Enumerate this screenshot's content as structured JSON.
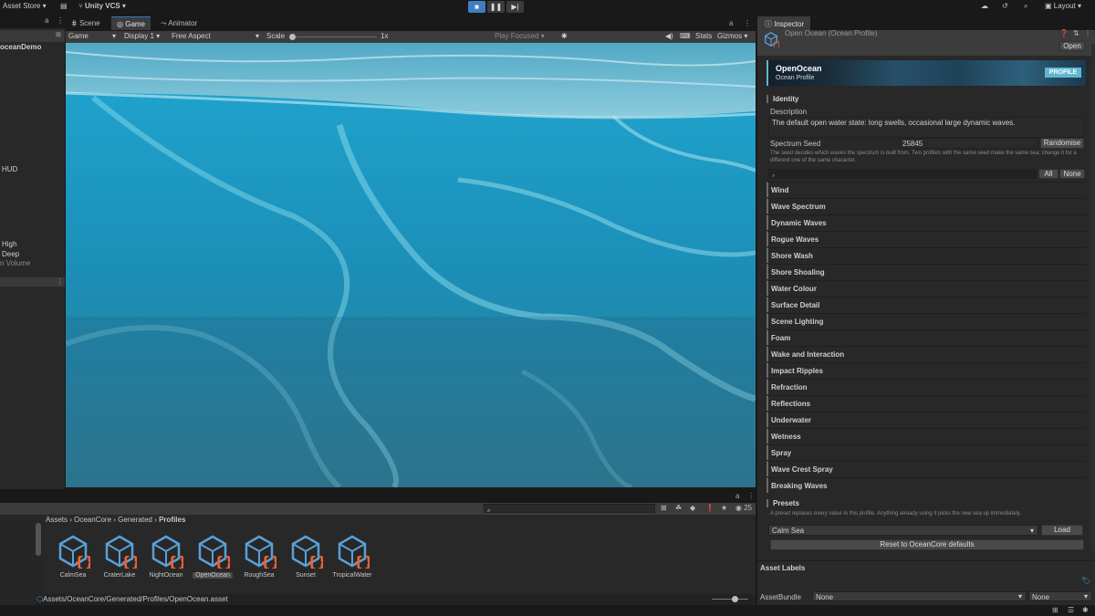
{
  "toolbar": {
    "asset_store": "Asset Store",
    "vcs": "Unity VCS",
    "layout": "Layout"
  },
  "hierarchy": {
    "rows": [
      "oceanDemo",
      "HUD",
      "High",
      "Deep",
      "n Volume"
    ]
  },
  "game_view": {
    "tabs": [
      "Scene",
      "Game",
      "Animator"
    ],
    "mode": "Game",
    "display": "Display 1",
    "aspect": "Free Aspect",
    "scale_label": "Scale",
    "scale_value": "1x",
    "play_focused": "Play Focused",
    "stats": "Stats",
    "gizmos": "Gizmos"
  },
  "inspector": {
    "tab": "Inspector",
    "object_title": "Open Ocean (Ocean Profile)",
    "open_button": "Open",
    "banner": {
      "title": "OpenOcean",
      "subtitle": "Ocean Profile",
      "badge": "PROFILE"
    },
    "identity_header": "Identity",
    "description_label": "Description",
    "description_value": "The default open water state: long swells, occasional large dynamic waves.",
    "seed_label": "Spectrum Seed",
    "seed_value": "25845",
    "randomise_button": "Randomise",
    "seed_help": "The seed decides which waves the spectrum is built from. Two profiles with the same seed make the same sea; change it for a different one of the same character.",
    "all_button": "All",
    "none_button": "None",
    "sections": [
      "Wind",
      "Wave Spectrum",
      "Dynamic Waves",
      "Rogue Waves",
      "Shore Wash",
      "Shore Shoaling",
      "Water Colour",
      "Surface Detail",
      "Scene Lighting",
      "Foam",
      "Wake and Interaction",
      "Impact Ripples",
      "Refraction",
      "Reflections",
      "Underwater",
      "Wetness",
      "Spray",
      "Wave Crest Spray",
      "Breaking Waves"
    ],
    "presets_header": "Presets",
    "presets_help": "A preset replaces every value in this profile. Anything already using it picks the new sea up immediately.",
    "preset_value": "Calm Sea",
    "load_button": "Load",
    "reset_button": "Reset to OceanCore defaults",
    "asset_labels": "Asset Labels",
    "asset_bundle_label": "AssetBundle",
    "asset_bundle_value": "None",
    "asset_bundle_variant": "None"
  },
  "project": {
    "breadcrumb": [
      "Assets",
      "OceanCore",
      "Generated",
      "Profiles"
    ],
    "assets": [
      "CalmSea",
      "CraterLake",
      "NightOcean",
      "OpenOcean",
      "RoughSea",
      "Sunset",
      "TropicalWater"
    ],
    "selected_asset": "OpenOcean",
    "path": "Assets/OceanCore/Generated/Profiles/OpenOcean.asset",
    "item_count": "25"
  },
  "colors": {
    "accent": "#3f7fc1",
    "icon_blue": "#5aa0d8",
    "icon_orange": "#e8643c",
    "badge": "#5fb8d0"
  }
}
